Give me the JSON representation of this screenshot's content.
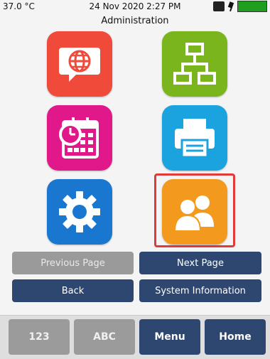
{
  "status": {
    "temperature": "37.0 °C",
    "datetime": "24 Nov 2020 2:27 PM"
  },
  "screen_title": "Administration",
  "tiles": [
    {
      "icon": "globe-speech-icon",
      "color": "#f04a3a"
    },
    {
      "icon": "network-hierarchy-icon",
      "color": "#7ab51d"
    },
    {
      "icon": "calendar-clock-icon",
      "color": "#e0188a"
    },
    {
      "icon": "printer-icon",
      "color": "#1ba3e0"
    },
    {
      "icon": "gear-icon",
      "color": "#1a77cf"
    },
    {
      "icon": "users-icon",
      "color": "#f39a1e",
      "selected": true
    }
  ],
  "buttons": {
    "previous_page": "Previous Page",
    "next_page": "Next Page",
    "back": "Back",
    "system_information": "System Information"
  },
  "footer": {
    "numeric": "123",
    "alpha": "ABC",
    "menu": "Menu",
    "home": "Home"
  }
}
